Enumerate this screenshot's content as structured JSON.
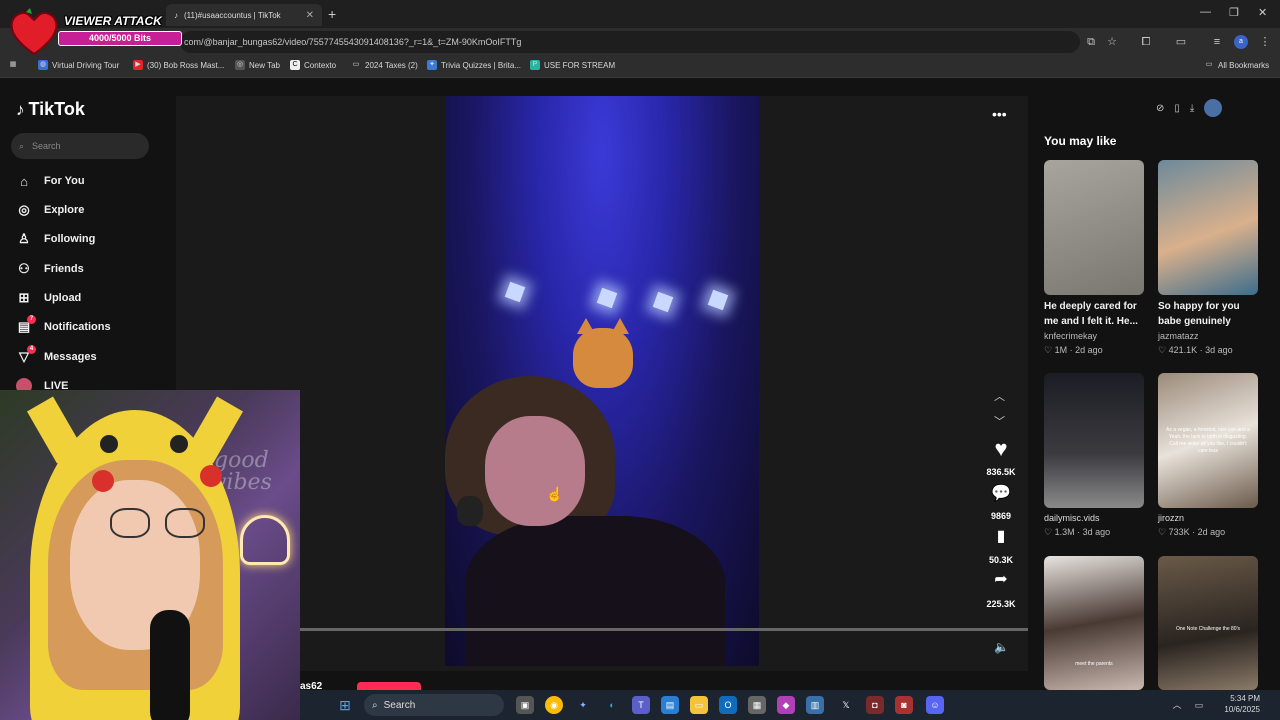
{
  "browser": {
    "tabs": [
      {
        "label": "(11)#usaaccountus | TikTok",
        "active": true
      }
    ],
    "url": "com/@banjar_bungas62/video/7557745543091408136?_r=1&_t=ZM-90KmOoIFTTg",
    "bookmarks": [
      "Virtual Driving Tour",
      "(30) Bob Ross Mast...",
      "New Tab",
      "Contexto",
      "2024 Taxes (2)",
      "Trivia Quizzes | Brita...",
      "USE FOR STREAM"
    ],
    "all_bookmarks": "All Bookmarks"
  },
  "overlay": {
    "title": "VIEWER ATTACK",
    "bits": "4000/5000 Bits"
  },
  "tiktok": {
    "logo": "TikTok",
    "search_placeholder": "Search",
    "nav": [
      {
        "label": "For You",
        "icon": "home-icon"
      },
      {
        "label": "Explore",
        "icon": "compass-icon"
      },
      {
        "label": "Following",
        "icon": "following-icon"
      },
      {
        "label": "Friends",
        "icon": "friends-icon"
      },
      {
        "label": "Upload",
        "icon": "upload-icon"
      },
      {
        "label": "Notifications",
        "icon": "bell-icon",
        "badge": "7"
      },
      {
        "label": "Messages",
        "icon": "send-icon",
        "badge": "4"
      },
      {
        "label": "LIVE",
        "icon": "live-icon"
      }
    ],
    "video": {
      "likes": "836.5K",
      "comments": "9869",
      "saves": "50.3K",
      "shares": "225.3K",
      "author_partial": "as62"
    },
    "you_may_like": "You may like",
    "cards": [
      {
        "title": "He deeply cared for me and I felt it. He...",
        "author": "knfecrimekay",
        "likes": "1M",
        "age": "2d ago",
        "overlay": ""
      },
      {
        "title": "So happy for you babe genuinely",
        "author": "jazmatazz",
        "likes": "421.1K",
        "age": "3d ago",
        "overlay": ""
      },
      {
        "title": "",
        "author": "dailymisc.vids",
        "likes": "1.3M",
        "age": "3d ago",
        "overlay": ""
      },
      {
        "title": "",
        "author": "jirozzn",
        "likes": "733K",
        "age": "2d ago",
        "overlay": "As a vegan, a feminist, non-con and a Yeah, the lack to birth is disgusting. Call me woke all you like, I couldn't care less"
      },
      {
        "title": "",
        "author": "",
        "likes": "",
        "age": "",
        "overlay": "meet the parents"
      },
      {
        "title": "",
        "author": "",
        "likes": "",
        "age": "",
        "overlay": "One Note Challenge the 80's"
      }
    ]
  },
  "taskbar": {
    "search": "Search",
    "time": "5:34 PM",
    "date": "10/6/2025"
  },
  "colors": {
    "accent": "#fe2c55",
    "overlay_bar": "#c71f96"
  }
}
